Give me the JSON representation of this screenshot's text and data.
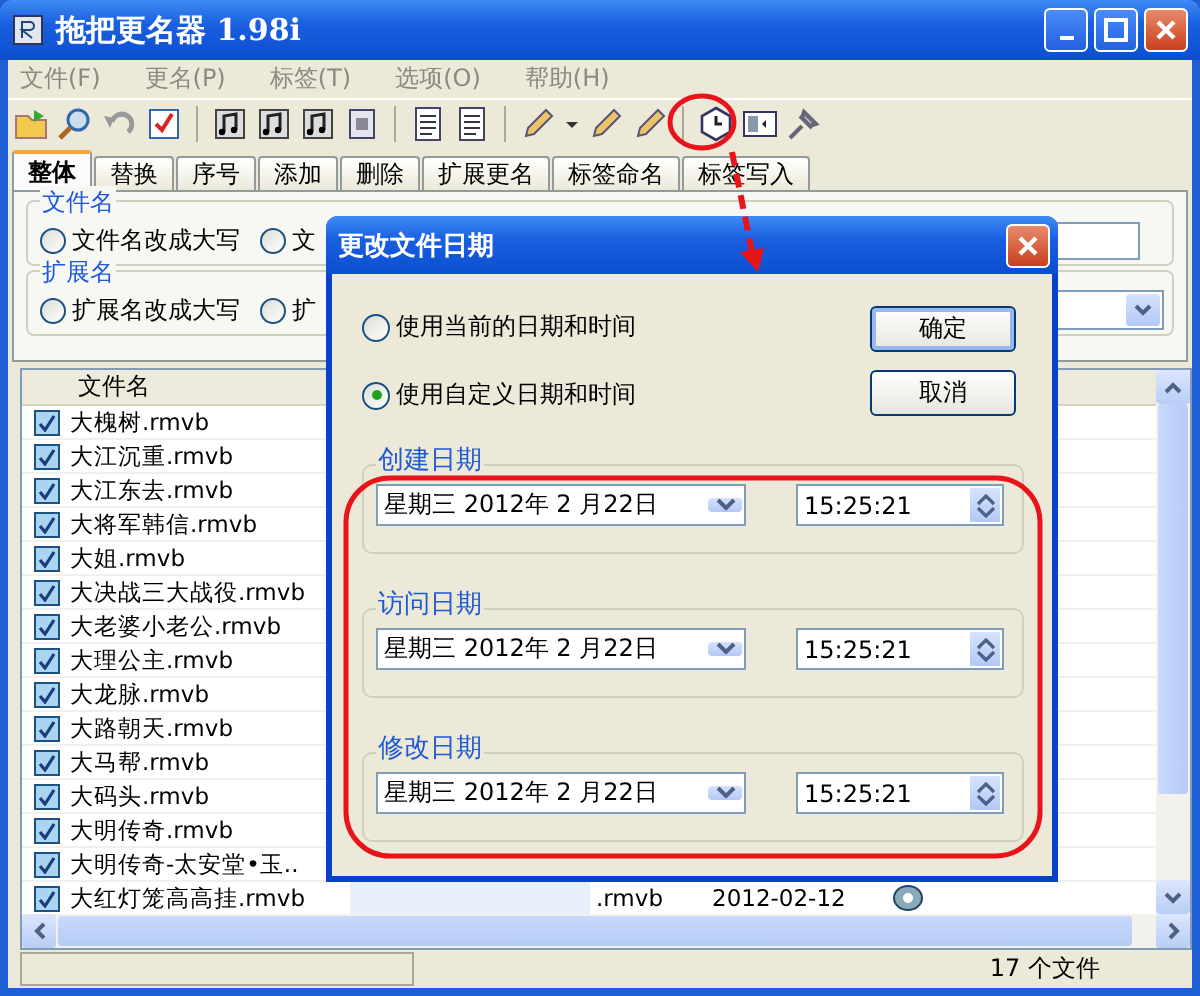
{
  "window": {
    "title": "拖把更名器 1.98i"
  },
  "menu": [
    "文件(F)",
    "更名(P)",
    "标签(T)",
    "选项(O)",
    "帮助(H)"
  ],
  "tabs": [
    {
      "label": "整体",
      "selected": true
    },
    {
      "label": "替换",
      "selected": false
    },
    {
      "label": "序号",
      "selected": false
    },
    {
      "label": "添加",
      "selected": false
    },
    {
      "label": "删除",
      "selected": false
    },
    {
      "label": "扩展更名",
      "selected": false
    },
    {
      "label": "标签命名",
      "selected": false
    },
    {
      "label": "标签写入",
      "selected": false
    }
  ],
  "filename_group": {
    "title": "文件名",
    "options": [
      {
        "label": "文件名改成大写",
        "selected": false
      },
      {
        "label": "文",
        "selected": false
      }
    ]
  },
  "extension_group": {
    "title": "扩展名",
    "options": [
      {
        "label": "扩展名改成大写",
        "selected": false
      },
      {
        "label": "扩",
        "selected": false
      }
    ]
  },
  "file_list": {
    "columns": [
      "文件名"
    ],
    "rows": [
      {
        "name": "大槐树.rmvb",
        "checked": true
      },
      {
        "name": "大江沉重.rmvb",
        "checked": true
      },
      {
        "name": "大江东去.rmvb",
        "checked": true
      },
      {
        "name": "大将军韩信.rmvb",
        "checked": true
      },
      {
        "name": "大姐.rmvb",
        "checked": true
      },
      {
        "name": "大决战三大战役.rmvb",
        "checked": true
      },
      {
        "name": "大老婆小老公.rmvb",
        "checked": true
      },
      {
        "name": "大理公主.rmvb",
        "checked": true
      },
      {
        "name": "大龙脉.rmvb",
        "checked": true
      },
      {
        "name": "大路朝天.rmvb",
        "checked": true
      },
      {
        "name": "大马帮.rmvb",
        "checked": true
      },
      {
        "name": "大码头.rmvb",
        "checked": true
      },
      {
        "name": "大明传奇.rmvb",
        "checked": true
      },
      {
        "name": "大明传奇-太安堂•玉..",
        "checked": true
      },
      {
        "name": "大红灯笼高高挂.rmvb",
        "checked": true,
        "extension": ".rmvb",
        "date": "2012-02-12"
      }
    ]
  },
  "status_bar": {
    "count": "17 个文件"
  },
  "dialog": {
    "title": "更改文件日期",
    "options": [
      {
        "label": "使用当前的日期和时间",
        "selected": false
      },
      {
        "label": "使用自定义日期和时间",
        "selected": true
      }
    ],
    "buttons": [
      "确定",
      "取消"
    ],
    "date_groups": [
      {
        "title": "创建日期",
        "date": "星期三 2012年 2 月22日",
        "time": "15:25:21"
      },
      {
        "title": "访问日期",
        "date": "星期三 2012年 2 月22日",
        "time": "15:25:21"
      },
      {
        "title": "修改日期",
        "date": "星期三 2012年 2 月22日",
        "time": "15:25:21"
      }
    ]
  }
}
